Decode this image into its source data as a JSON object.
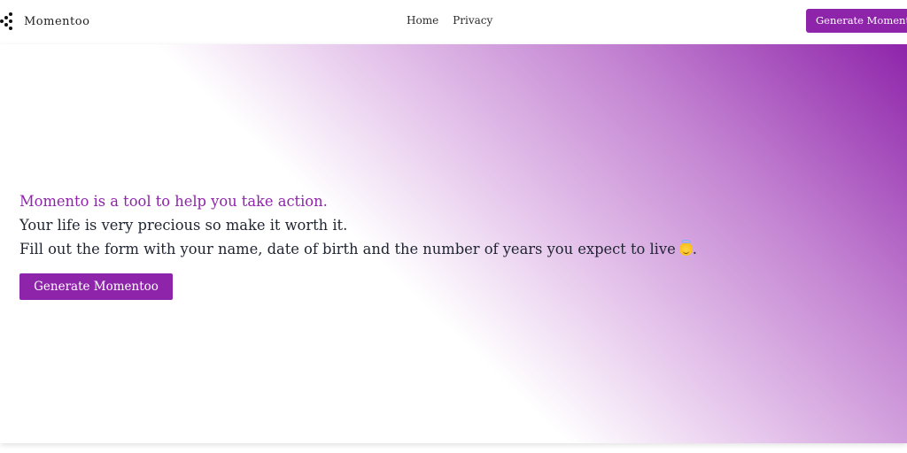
{
  "navbar": {
    "brand_name": "Momentoo",
    "links": [
      "Home",
      "Privacy"
    ],
    "cta_label": "Generate Momentoo"
  },
  "hero": {
    "tagline": "Momento is a tool to help you take action.",
    "line2": "Your life is very precious so make it worth it.",
    "line3": "Fill out the form with your name, date of birth and the number of years you expect to live",
    "line3_end": ".",
    "emoji_icon": "smiling-face-with-halo-icon",
    "cta_label": "Generate Momentoo"
  },
  "colors": {
    "accent": "#8e24aa",
    "text_dark": "#1e2430"
  }
}
